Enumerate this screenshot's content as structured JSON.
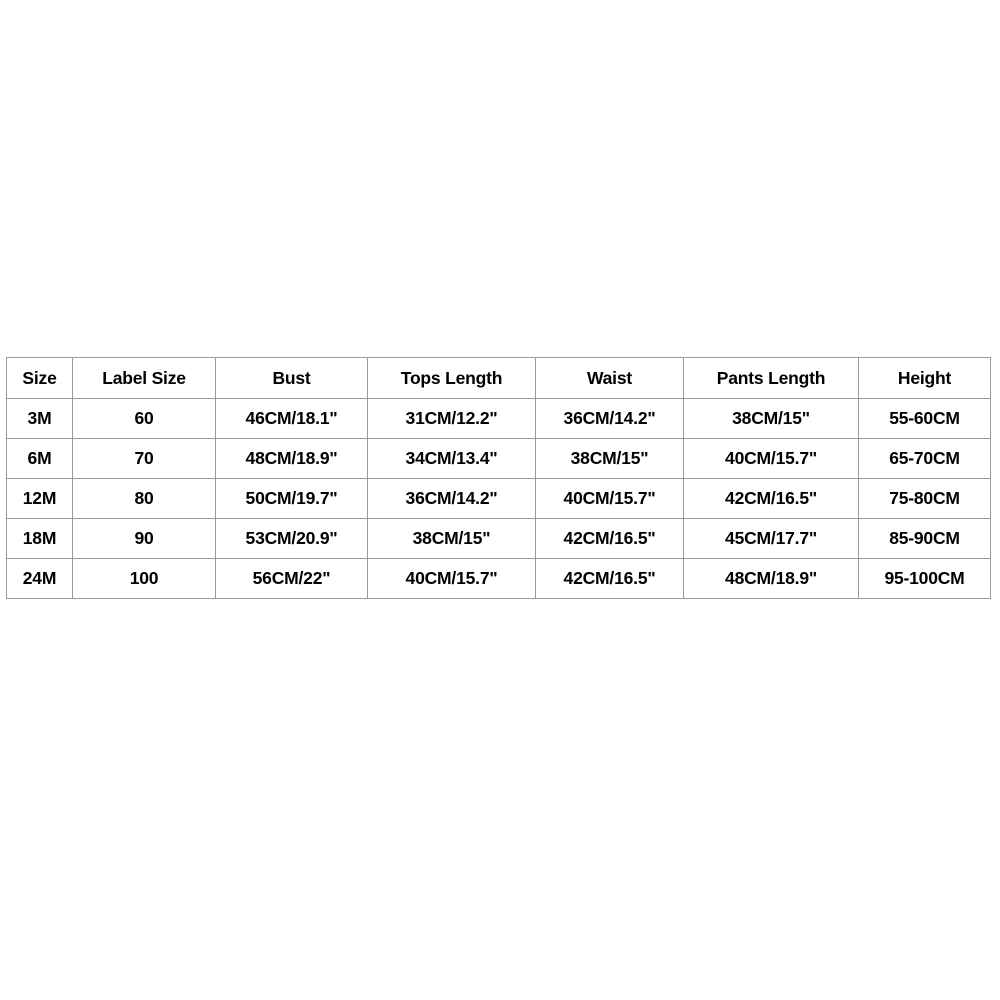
{
  "chart_data": {
    "type": "table",
    "title": "",
    "columns": [
      "Size",
      "Label Size",
      "Bust",
      "Tops Length",
      "Waist",
      "Pants Length",
      "Height"
    ],
    "rows": [
      [
        "3M",
        "60",
        "46CM/18.1\"",
        "31CM/12.2\"",
        "36CM/14.2\"",
        "38CM/15\"",
        "55-60CM"
      ],
      [
        "6M",
        "70",
        "48CM/18.9\"",
        "34CM/13.4\"",
        "38CM/15\"",
        "40CM/15.7\"",
        "65-70CM"
      ],
      [
        "12M",
        "80",
        "50CM/19.7\"",
        "36CM/14.2\"",
        "40CM/15.7\"",
        "42CM/16.5\"",
        "75-80CM"
      ],
      [
        "18M",
        "90",
        "53CM/20.9\"",
        "38CM/15\"",
        "42CM/16.5\"",
        "45CM/17.7\"",
        "85-90CM"
      ],
      [
        "24M",
        "100",
        "56CM/22\"",
        "40CM/15.7\"",
        "42CM/16.5\"",
        "48CM/18.9\"",
        "95-100CM"
      ]
    ]
  },
  "table": {
    "headers": [
      {
        "key": "size",
        "label": "Size"
      },
      {
        "key": "label_size",
        "label": "Label Size"
      },
      {
        "key": "bust",
        "label": "Bust"
      },
      {
        "key": "tops_length",
        "label": "Tops Length"
      },
      {
        "key": "waist",
        "label": "Waist"
      },
      {
        "key": "pants_length",
        "label": "Pants Length"
      },
      {
        "key": "height",
        "label": "Height"
      }
    ],
    "rows": [
      {
        "size": "3M",
        "label_size": "60",
        "bust": "46CM/18.1\"",
        "tops_length": "31CM/12.2\"",
        "waist": "36CM/14.2\"",
        "pants_length": "38CM/15\"",
        "height": "55-60CM"
      },
      {
        "size": "6M",
        "label_size": "70",
        "bust": "48CM/18.9\"",
        "tops_length": "34CM/13.4\"",
        "waist": "38CM/15\"",
        "pants_length": "40CM/15.7\"",
        "height": "65-70CM"
      },
      {
        "size": "12M",
        "label_size": "80",
        "bust": "50CM/19.7\"",
        "tops_length": "36CM/14.2\"",
        "waist": "40CM/15.7\"",
        "pants_length": "42CM/16.5\"",
        "height": "75-80CM"
      },
      {
        "size": "18M",
        "label_size": "90",
        "bust": "53CM/20.9\"",
        "tops_length": "38CM/15\"",
        "waist": "42CM/16.5\"",
        "pants_length": "45CM/17.7\"",
        "height": "85-90CM"
      },
      {
        "size": "24M",
        "label_size": "100",
        "bust": "56CM/22\"",
        "tops_length": "40CM/15.7\"",
        "waist": "42CM/16.5\"",
        "pants_length": "48CM/18.9\"",
        "height": "95-100CM"
      }
    ]
  },
  "style": {
    "border_color": "#9a9a9a",
    "text_color": "#000000",
    "background_color": "#ffffff"
  }
}
